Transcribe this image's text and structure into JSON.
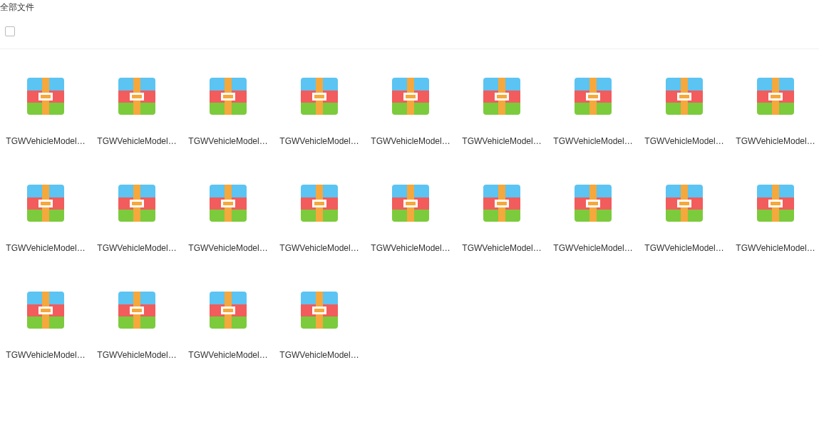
{
  "breadcrumb": "全部文件",
  "select_all": {
    "checked": false
  },
  "files": [
    {
      "name": "TGWVehicleModel…"
    },
    {
      "name": "TGWVehicleModel…"
    },
    {
      "name": "TGWVehicleModel…"
    },
    {
      "name": "TGWVehicleModel…"
    },
    {
      "name": "TGWVehicleModel…"
    },
    {
      "name": "TGWVehicleModel…"
    },
    {
      "name": "TGWVehicleModel…"
    },
    {
      "name": "TGWVehicleModel…"
    },
    {
      "name": "TGWVehicleModel…"
    },
    {
      "name": "TGWVehicleModel…"
    },
    {
      "name": "TGWVehicleModel…"
    },
    {
      "name": "TGWVehicleModel…"
    },
    {
      "name": "TGWVehicleModel…"
    },
    {
      "name": "TGWVehicleModel…"
    },
    {
      "name": "TGWVehicleModel…"
    },
    {
      "name": "TGWVehicleModel…"
    },
    {
      "name": "TGWVehicleModel…"
    },
    {
      "name": "TGWVehicleModel…"
    },
    {
      "name": "TGWVehicleModel…"
    },
    {
      "name": "TGWVehicleModel…"
    },
    {
      "name": "TGWVehicleModel…"
    },
    {
      "name": "TGWVehicleModel…"
    }
  ]
}
